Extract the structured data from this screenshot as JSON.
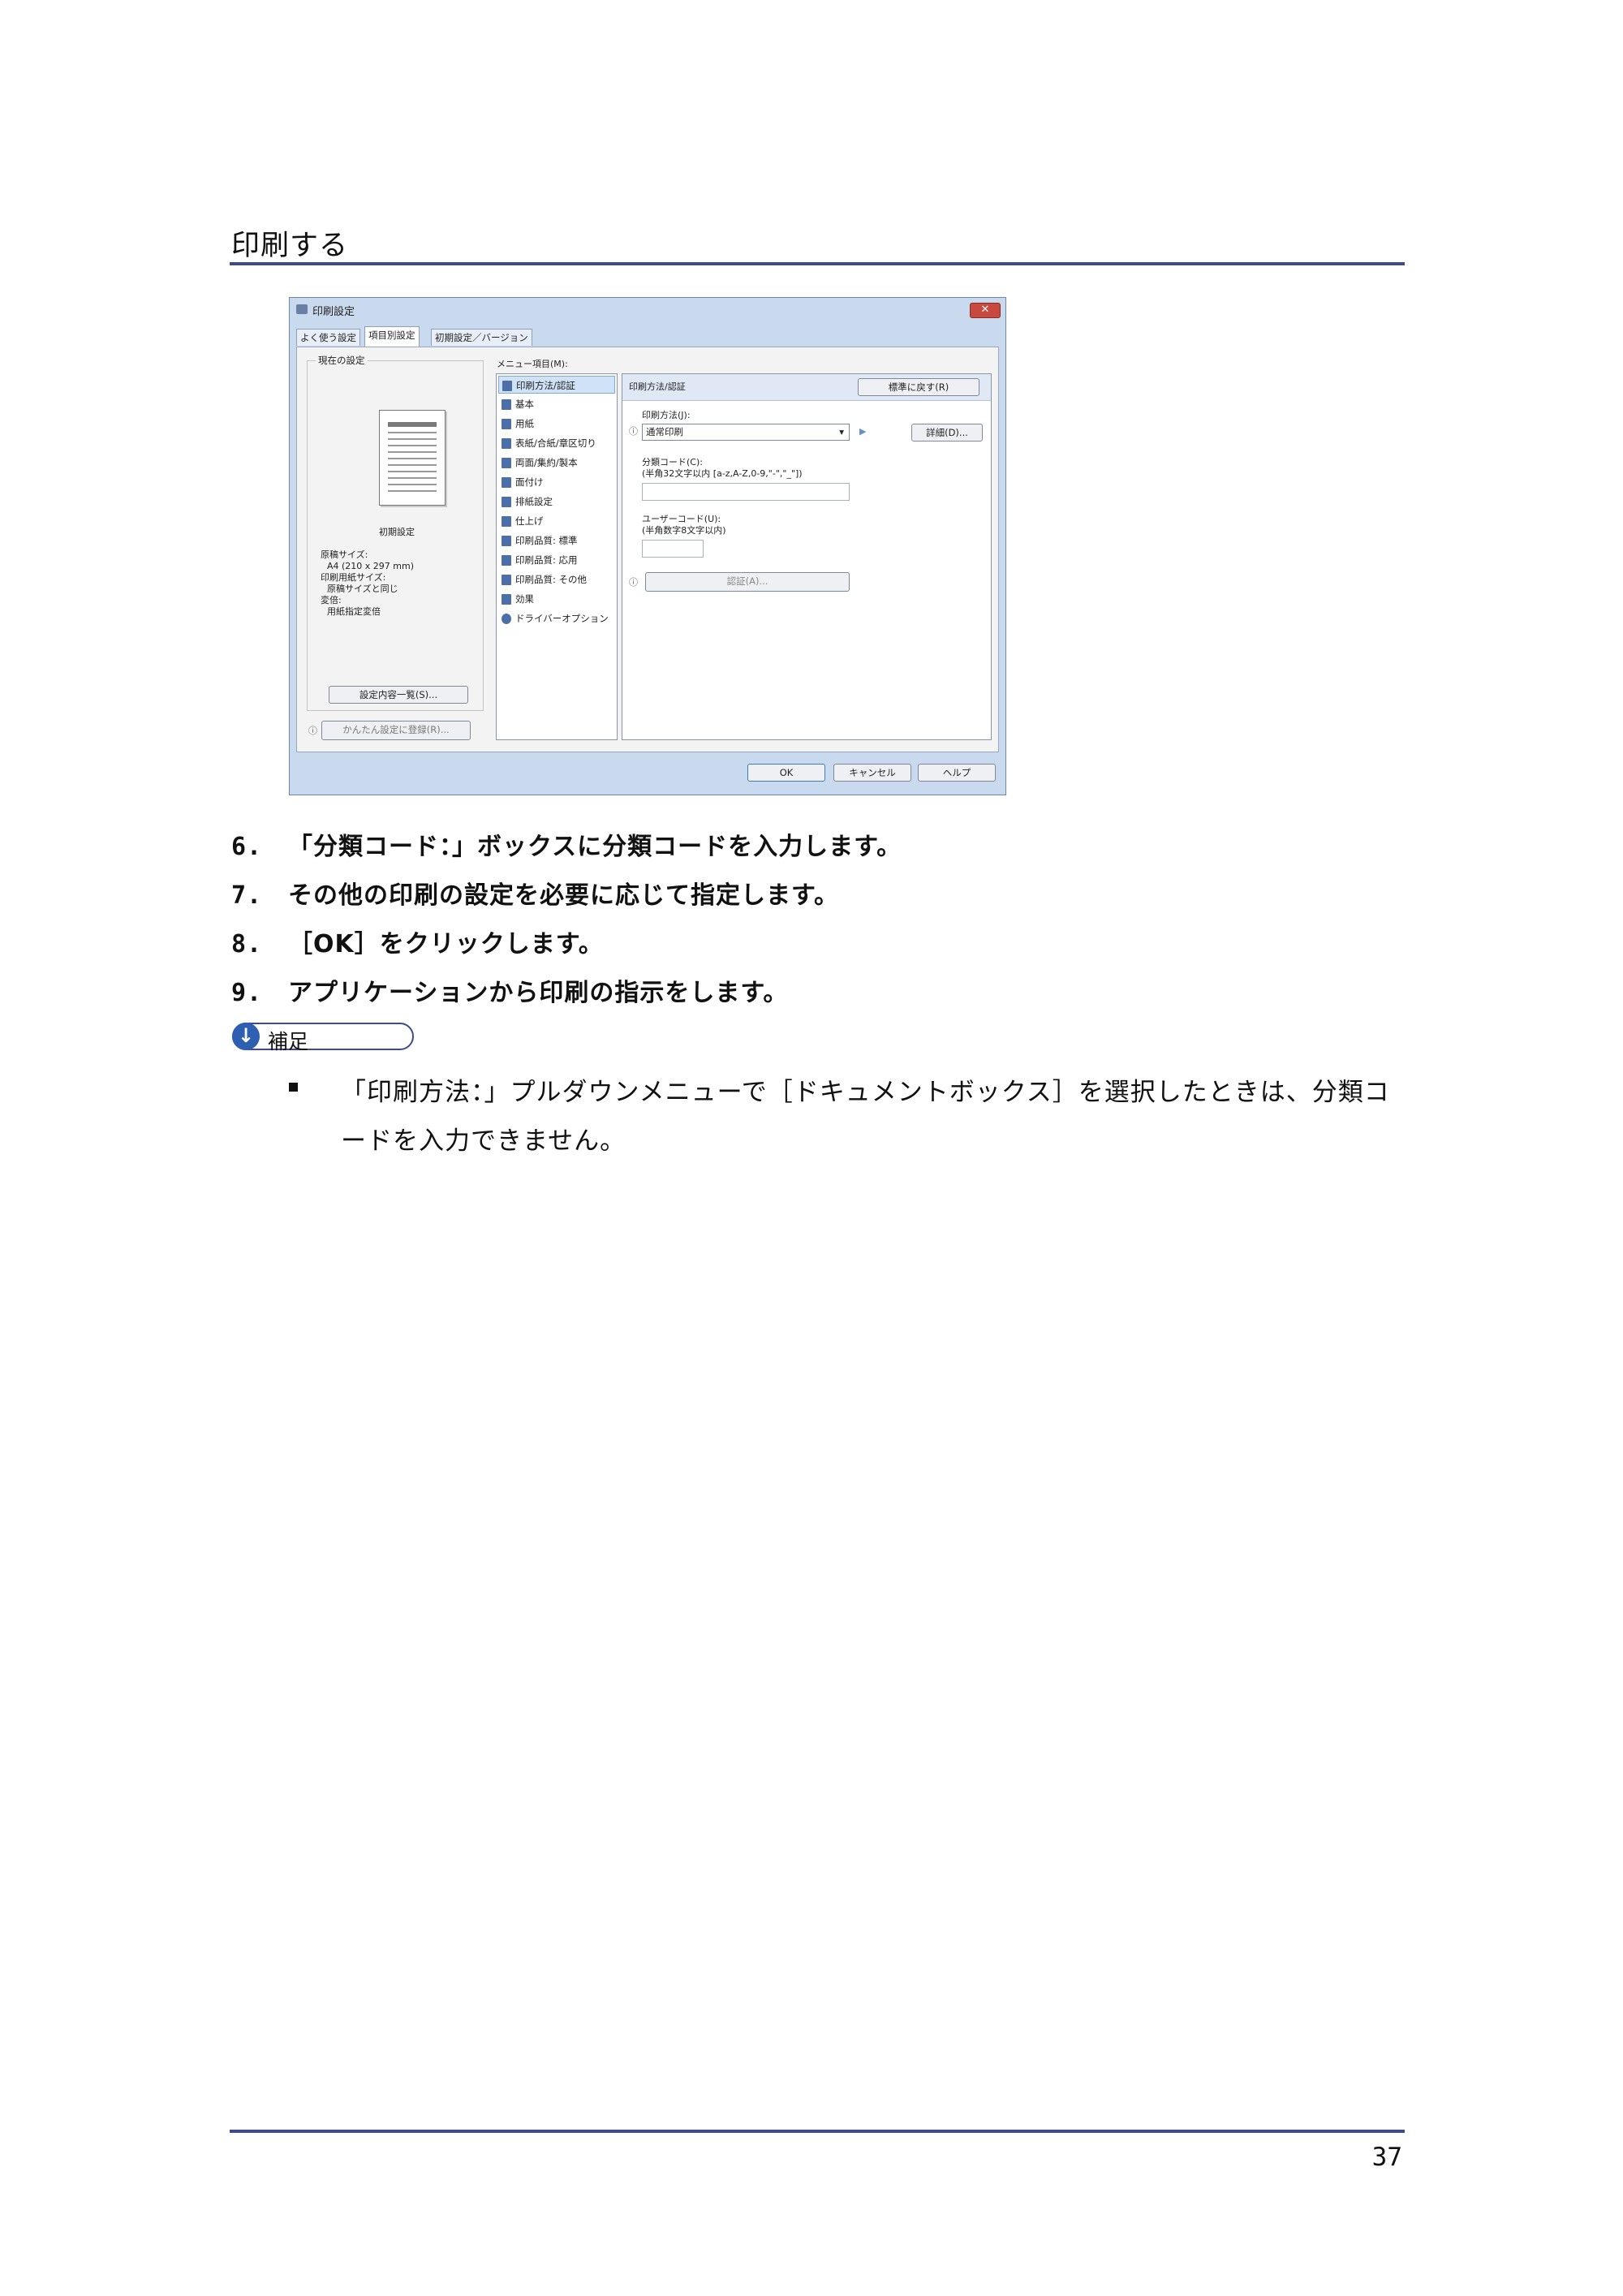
{
  "header": {
    "section_title": "印刷する"
  },
  "dialog": {
    "title": "印刷設定",
    "close_label": "✕",
    "tabs": [
      "よく使う設定",
      "項目別設定",
      "初期設定／バージョン"
    ],
    "preview": {
      "group_label": "現在の設定",
      "caption": "初期設定",
      "info_lines": [
        "原稿サイズ:",
        "A4 (210 x 297 mm)",
        "印刷用紙サイズ:",
        "原稿サイズと同じ",
        "変倍:",
        "用紙指定変倍"
      ],
      "list_button": "設定内容一覧(S)...",
      "register_button": "かんたん設定に登録(R)..."
    },
    "menu_label": "メニュー項目(M):",
    "menu_items": [
      "印刷方法/認証",
      "基本",
      "用紙",
      "表紙/合紙/章区切り",
      "両面/集約/製本",
      "面付け",
      "排紙設定",
      "仕上げ",
      "印刷品質: 標準",
      "印刷品質: 応用",
      "印刷品質: その他",
      "効果",
      "ドライバーオプション"
    ],
    "right_panel": {
      "header_label": "印刷方法/認証",
      "reset_button": "標準に戻す(R)",
      "print_method_label": "印刷方法(J):",
      "print_method_value": "通常印刷",
      "details_button": "詳細(D)...",
      "class_code_label": "分類コード(C):",
      "class_code_hint": "(半角32文字以内 [a-z,A-Z,0-9,\"-\",\"_\"])",
      "user_code_label": "ユーザーコード(U):",
      "user_code_hint": "(半角数字8文字以内)",
      "auth_button": "認証(A)..."
    },
    "footer_buttons": {
      "ok": "OK",
      "cancel": "キャンセル",
      "help": "ヘルプ"
    },
    "info_glyph": "ⓘ"
  },
  "steps": [
    {
      "num": "6.",
      "text": "「分類コード：」ボックスに分類コードを入力します。"
    },
    {
      "num": "7.",
      "text": "その他の印刷の設定を必要に応じて指定します。"
    },
    {
      "num": "8.",
      "text": "［OK］をクリックします。"
    },
    {
      "num": "9.",
      "text": "アプリケーションから印刷の指示をします。"
    }
  ],
  "note": {
    "label": "補足",
    "text": "「印刷方法：」プルダウンメニューで［ドキュメントボックス］を選択したときは、分類コードを入力できません。"
  },
  "footer": {
    "page_number": "37"
  },
  "colors": {
    "rule": "#3f4a8a",
    "dialog_bg": "#c9d9ee",
    "note_icon": "#2e5fb0"
  }
}
